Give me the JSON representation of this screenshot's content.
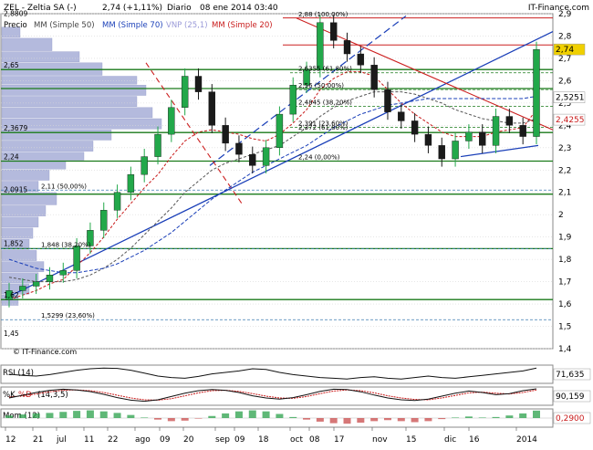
{
  "header": {
    "symbol": "ZEL - Zeltia SA (-)",
    "quote": "2,74 (+1,11%)",
    "period": "Diario",
    "datetime": "08 ene 2014 03:40",
    "brand": "IT-Finance.com"
  },
  "legend": {
    "items": [
      {
        "label": "Precio",
        "color": "#000000"
      },
      {
        "label": "MM (Simple 50)",
        "color": "#444444"
      },
      {
        "label": "MM (Simple 70)",
        "color": "#1a3fb8"
      },
      {
        "label": "VNP (25,1)",
        "color": "#9a9ad8"
      },
      {
        "label": "MM (Simple 20)",
        "color": "#c81a1a"
      }
    ]
  },
  "watermark": "© IT-Finance.com",
  "colors": {
    "up": "#22a84a",
    "down": "#1a1a1a",
    "support": "#1a7a1a",
    "resistance": "#cc2020",
    "trend": "#1a3fb8",
    "volume_profile": "#a8aed8"
  },
  "chart_data": [
    {
      "type": "candlestick",
      "title": "ZEL - Zeltia SA (-)",
      "ylim": [
        1.45,
        2.85
      ],
      "y_ticks": [
        "2,9",
        "2,8",
        "2,7",
        "2,6",
        "2,5",
        "2,4",
        "2,3",
        "2,2",
        "2,1",
        "2",
        "1,9",
        "1,8",
        "1,7",
        "1,6",
        "1,5",
        "1,4"
      ],
      "x_ticks": [
        "12",
        "21",
        "jul",
        "11",
        "22",
        "ago",
        "09",
        "20",
        "sep",
        "09",
        "18",
        "oct",
        "08",
        "17",
        "nov",
        "15",
        "dic",
        "16",
        "2014"
      ],
      "price_labels": [
        {
          "text": "2,74",
          "value": 2.74,
          "color": "#f0d000"
        },
        {
          "text": "2,5251",
          "value": 2.5251,
          "color": "#ffffff"
        },
        {
          "text": "2,4255",
          "value": 2.4255,
          "color": "#ffffff"
        }
      ],
      "levels": [
        {
          "value": 2.88,
          "text": "2,88 (100,00%)"
        },
        {
          "value": 2.6355,
          "text": "2,6355 (61,80%)"
        },
        {
          "value": 2.56,
          "text": "2,56 (50,00%)"
        },
        {
          "value": 2.4845,
          "text": "2,4845 (38,20%)"
        },
        {
          "value": 2.391,
          "text": "2,391 (23,60%)"
        },
        {
          "value": 2.24,
          "text": "2,24 (0,00%)"
        },
        {
          "value": 2.372,
          "text": "2,372 (61,80%)"
        },
        {
          "value": 2.11,
          "text": "2,11 (50,00%)"
        },
        {
          "value": 1.848,
          "text": "1,848 (38,20%)"
        },
        {
          "value": 1.5299,
          "text": "1,5299 (23,60%)"
        }
      ],
      "left_labels": [
        {
          "text": "2,8809",
          "value": 2.881
        },
        {
          "text": "2,65",
          "value": 2.65
        },
        {
          "text": "2,3679",
          "value": 2.368
        },
        {
          "text": "2,24",
          "value": 2.24
        },
        {
          "text": "2,0915",
          "value": 2.092
        },
        {
          "text": "1,852",
          "value": 1.852
        },
        {
          "text": "1,62",
          "value": 1.62
        },
        {
          "text": "1,45",
          "value": 1.45
        }
      ],
      "series": [
        {
          "name": "Precio",
          "values": [
            1.66,
            1.68,
            1.7,
            1.73,
            1.75,
            1.86,
            1.93,
            2.02,
            2.1,
            2.18,
            2.26,
            2.36,
            2.48,
            2.62,
            2.55,
            2.4,
            2.32,
            2.27,
            2.22,
            2.3,
            2.45,
            2.58,
            2.65,
            2.86,
            2.78,
            2.72,
            2.67,
            2.56,
            2.46,
            2.42,
            2.36,
            2.31,
            2.25,
            2.33,
            2.37,
            2.31,
            2.44,
            2.4,
            2.35,
            2.74
          ]
        },
        {
          "name": "MM (Simple 20)",
          "values": [
            1.62,
            1.64,
            1.66,
            1.69,
            1.71,
            1.77,
            1.83,
            1.9,
            1.98,
            2.05,
            2.12,
            2.18,
            2.26,
            2.33,
            2.37,
            2.38,
            2.37,
            2.36,
            2.34,
            2.33,
            2.36,
            2.41,
            2.47,
            2.56,
            2.61,
            2.64,
            2.64,
            2.62,
            2.56,
            2.5,
            2.45,
            2.41,
            2.37,
            2.35,
            2.35,
            2.35,
            2.37,
            2.38,
            2.39,
            2.47
          ]
        },
        {
          "name": "MM (Simple 50)",
          "values": [
            1.72,
            1.71,
            1.7,
            1.7,
            1.7,
            1.71,
            1.73,
            1.76,
            1.8,
            1.85,
            1.91,
            1.97,
            2.03,
            2.1,
            2.15,
            2.2,
            2.23,
            2.25,
            2.27,
            2.29,
            2.31,
            2.35,
            2.39,
            2.44,
            2.48,
            2.51,
            2.53,
            2.55,
            2.55,
            2.55,
            2.54,
            2.52,
            2.5,
            2.47,
            2.45,
            2.43,
            2.42,
            2.41,
            2.41,
            2.43
          ]
        },
        {
          "name": "MM (Simple 70)",
          "values": [
            1.8,
            1.78,
            1.76,
            1.75,
            1.74,
            1.74,
            1.75,
            1.76,
            1.78,
            1.81,
            1.84,
            1.88,
            1.92,
            1.97,
            2.02,
            2.07,
            2.11,
            2.15,
            2.19,
            2.22,
            2.25,
            2.28,
            2.31,
            2.35,
            2.39,
            2.42,
            2.45,
            2.47,
            2.49,
            2.5,
            2.51,
            2.52,
            2.52,
            2.52,
            2.52,
            2.52,
            2.52,
            2.52,
            2.52,
            2.53
          ]
        }
      ],
      "volume_profile": [
        {
          "from": 2.79,
          "to": 2.84,
          "value": 20
        },
        {
          "from": 2.73,
          "to": 2.79,
          "value": 55
        },
        {
          "from": 2.68,
          "to": 2.73,
          "value": 85
        },
        {
          "from": 2.62,
          "to": 2.68,
          "value": 110
        },
        {
          "from": 2.58,
          "to": 2.62,
          "value": 148
        },
        {
          "from": 2.53,
          "to": 2.58,
          "value": 158
        },
        {
          "from": 2.48,
          "to": 2.53,
          "value": 148
        },
        {
          "from": 2.43,
          "to": 2.48,
          "value": 165
        },
        {
          "from": 2.38,
          "to": 2.43,
          "value": 175
        },
        {
          "from": 2.33,
          "to": 2.38,
          "value": 120
        },
        {
          "from": 2.28,
          "to": 2.33,
          "value": 100
        },
        {
          "from": 2.24,
          "to": 2.28,
          "value": 90
        },
        {
          "from": 2.2,
          "to": 2.24,
          "value": 70
        },
        {
          "from": 2.15,
          "to": 2.2,
          "value": 52
        },
        {
          "from": 2.1,
          "to": 2.15,
          "value": 40
        },
        {
          "from": 2.04,
          "to": 2.1,
          "value": 60
        },
        {
          "from": 1.99,
          "to": 2.04,
          "value": 48
        },
        {
          "from": 1.94,
          "to": 1.99,
          "value": 40
        },
        {
          "from": 1.89,
          "to": 1.94,
          "value": 34
        },
        {
          "from": 1.84,
          "to": 1.89,
          "value": 30
        },
        {
          "from": 1.79,
          "to": 1.84,
          "value": 38
        },
        {
          "from": 1.74,
          "to": 1.79,
          "value": 46
        },
        {
          "from": 1.69,
          "to": 1.74,
          "value": 40
        },
        {
          "from": 1.64,
          "to": 1.69,
          "value": 30
        },
        {
          "from": 1.59,
          "to": 1.64,
          "value": 18
        }
      ]
    },
    {
      "type": "line",
      "title": "RSI (14)",
      "value_label": "71,635",
      "series": [
        {
          "name": "RSI (14)",
          "values": [
            55,
            52,
            50,
            54,
            60,
            66,
            70,
            72,
            71,
            66,
            58,
            50,
            46,
            44,
            49,
            56,
            60,
            64,
            70,
            68,
            60,
            54,
            50,
            46,
            44,
            42,
            46,
            48,
            44,
            42,
            46,
            50,
            46,
            44,
            48,
            52,
            56,
            60,
            64,
            72
          ]
        }
      ]
    },
    {
      "type": "line",
      "title": "%K %D (14,3,5)",
      "label_k": "%K",
      "label_d": "%D",
      "label_params": "(14,3,5)",
      "value_label": "90,159",
      "series": [
        {
          "name": "%K",
          "values": [
            40,
            55,
            70,
            82,
            88,
            84,
            75,
            60,
            42,
            28,
            22,
            30,
            48,
            66,
            80,
            86,
            82,
            70,
            52,
            40,
            34,
            42,
            58,
            76,
            88,
            86,
            74,
            56,
            40,
            30,
            26,
            34,
            50,
            66,
            78,
            70,
            58,
            64,
            80,
            90
          ]
        },
        {
          "name": "%D",
          "values": [
            45,
            52,
            62,
            74,
            82,
            84,
            80,
            70,
            55,
            40,
            30,
            28,
            36,
            52,
            68,
            80,
            82,
            76,
            64,
            50,
            40,
            38,
            48,
            64,
            78,
            84,
            80,
            68,
            52,
            40,
            32,
            30,
            40,
            54,
            68,
            72,
            66,
            62,
            70,
            84
          ]
        }
      ]
    },
    {
      "type": "bar",
      "title": "Mom (12)",
      "value_label": "0,2900",
      "series": [
        {
          "name": "Mom (12)",
          "values": [
            0.1,
            0.14,
            0.18,
            0.2,
            0.24,
            0.28,
            0.3,
            0.26,
            0.2,
            0.12,
            0.02,
            -0.06,
            -0.12,
            -0.1,
            -0.02,
            0.08,
            0.18,
            0.26,
            0.3,
            0.26,
            0.16,
            0.04,
            -0.06,
            -0.14,
            -0.2,
            -0.22,
            -0.18,
            -0.12,
            -0.08,
            -0.12,
            -0.16,
            -0.12,
            -0.04,
            0.02,
            0.06,
            0.02,
            0.04,
            0.1,
            0.18,
            0.29
          ]
        }
      ]
    }
  ]
}
